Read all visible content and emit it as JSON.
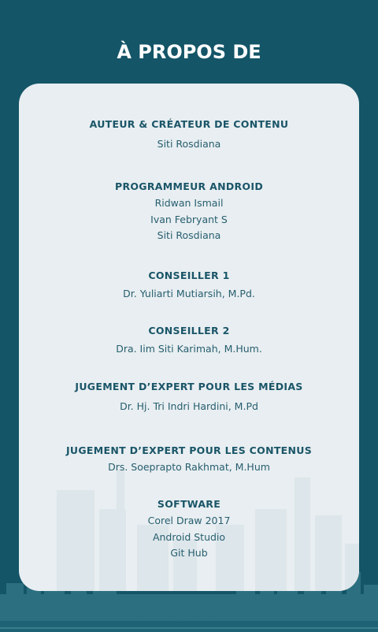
{
  "page": {
    "title": "À PROPOS DE",
    "colors": {
      "background": "#145567",
      "card": "#e8eef1",
      "heading": "#1a5568",
      "text": "#275e6f"
    }
  },
  "sections": [
    {
      "heading": "AUTEUR & CRÉATEUR DE CONTENU",
      "lines": [
        "Siti Rosdiana"
      ]
    },
    {
      "heading": "PROGRAMMEUR ANDROID",
      "lines": [
        "Ridwan Ismail",
        "Ivan Febryant S",
        "Siti Rosdiana"
      ]
    },
    {
      "heading": "CONSEILLER 1",
      "lines": [
        "Dr. Yuliarti Mutiarsih, M.Pd."
      ]
    },
    {
      "heading": "CONSEILLER 2",
      "lines": [
        "Dra. Iim Siti Karimah, M.Hum."
      ]
    },
    {
      "heading": "JUGEMENT D’EXPERT POUR LES MÉDIAS",
      "lines": [
        "Dr. Hj. Tri Indri Hardini, M.Pd"
      ]
    },
    {
      "heading": "JUGEMENT D’EXPERT POUR LES CONTENUS",
      "lines": [
        "Drs. Soeprapto Rakhmat, M.Hum"
      ]
    },
    {
      "heading": "SOFTWARE",
      "lines": [
        "Corel Draw 2017",
        "Android Studio",
        "Git Hub"
      ]
    }
  ]
}
